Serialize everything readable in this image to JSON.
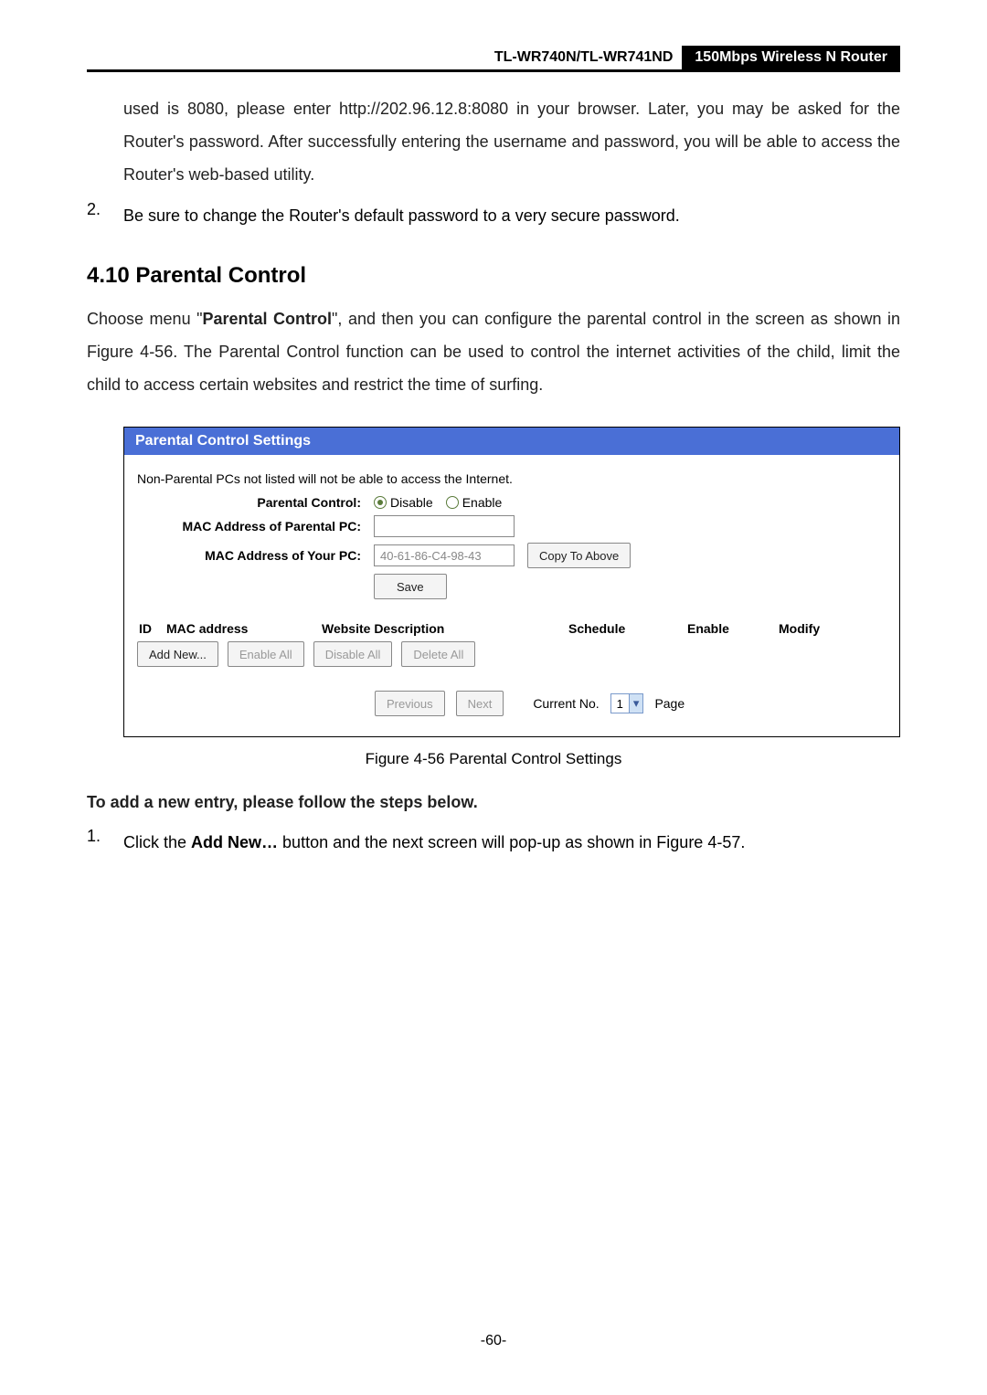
{
  "header": {
    "model": "TL-WR740N/TL-WR741ND",
    "product": "150Mbps Wireless N Router"
  },
  "intro_para": "used is 8080, please enter http://202.96.12.8:8080 in your browser. Later, you may be asked for the Router's password. After successfully entering the username and password, you will be able to access the Router's web-based utility.",
  "list2_num": "2.",
  "list2_text": "Be sure to change the Router's default password to a very secure password.",
  "section_heading": "4.10  Parental Control",
  "section_para_pre": "Choose menu \"",
  "section_para_bold": "Parental Control",
  "section_para_post": "\", and then you can configure the parental control in the screen as shown in Figure 4-56. The Parental Control function can be used to control the internet activities of the child, limit the child to access certain websites and restrict the time of surfing.",
  "figure": {
    "header": "Parental Control Settings",
    "note": "Non-Parental PCs not listed will not be able to access the Internet.",
    "labels": {
      "parental_control": "Parental Control:",
      "mac_parental": "MAC Address of Parental PC:",
      "mac_your": "MAC Address of Your PC:"
    },
    "radio_disable": "Disable",
    "radio_enable": "Enable",
    "mac_your_value": "40-61-86-C4-98-43",
    "buttons": {
      "copy": "Copy To Above",
      "save": "Save",
      "add_new": "Add New...",
      "enable_all": "Enable All",
      "disable_all": "Disable All",
      "delete_all": "Delete All",
      "previous": "Previous",
      "next": "Next"
    },
    "table": {
      "id": "ID",
      "mac": "MAC address",
      "desc": "Website Description",
      "schedule": "Schedule",
      "enable": "Enable",
      "modify": "Modify"
    },
    "pager": {
      "current_label": "Current No.",
      "value": "1",
      "page_label": "Page"
    }
  },
  "figure_caption": "Figure 4-56    Parental Control Settings",
  "steps_heading": "To add a new entry, please follow the steps below.",
  "step1_num": "1.",
  "step1_pre": "Click the ",
  "step1_bold": "Add New…",
  "step1_post": " button and the next screen will pop-up as shown in Figure 4-57.",
  "page_number": "-60-"
}
